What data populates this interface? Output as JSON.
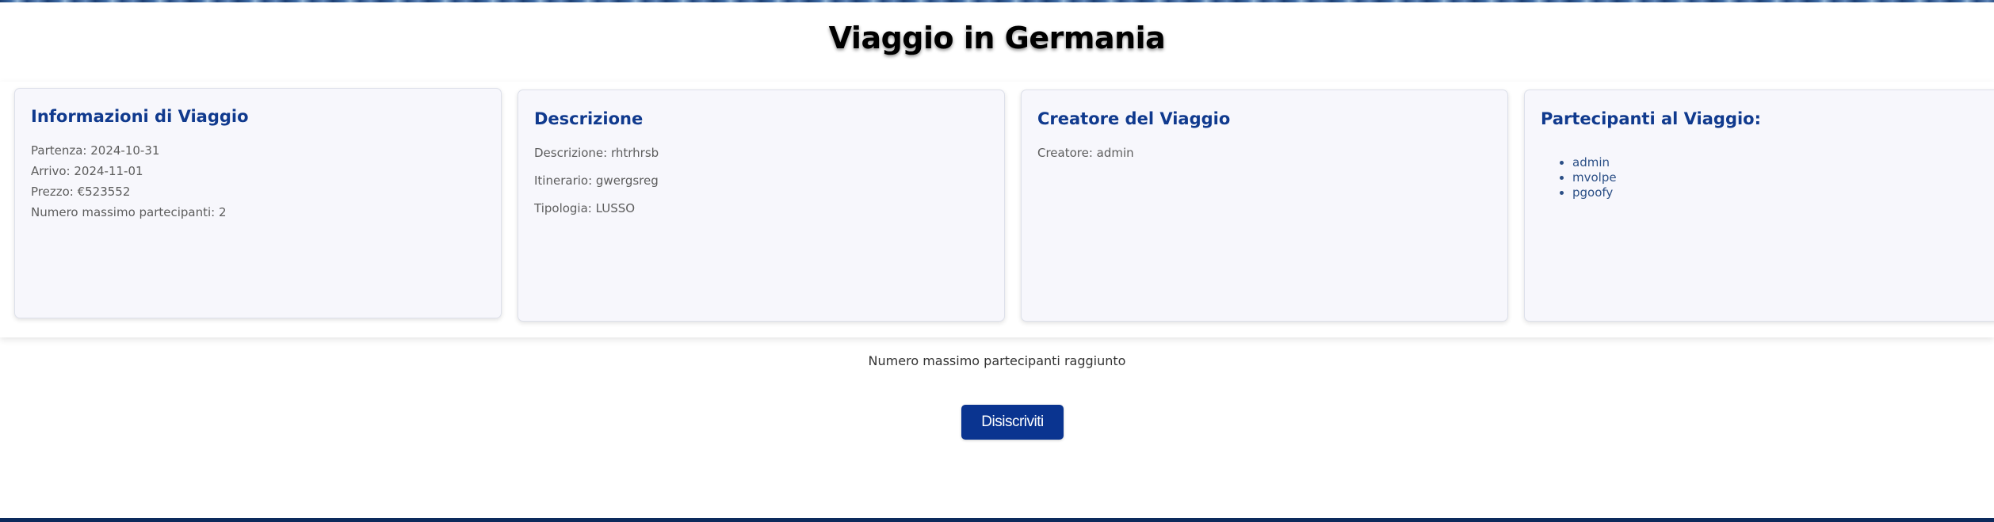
{
  "page": {
    "title": "Viaggio in Germania"
  },
  "travel_info": {
    "heading": "Informazioni di Viaggio",
    "lines": [
      "Partenza: 2024-10-31",
      "Arrivo: 2024-11-01",
      "Prezzo: €523552",
      "Numero massimo partecipanti: 2"
    ]
  },
  "description": {
    "heading": "Descrizione",
    "lines": [
      "Descrizione: rhtrhrsb",
      "Itinerario: gwergsreg",
      "Tipologia: LUSSO"
    ]
  },
  "creator": {
    "heading": "Creatore del Viaggio",
    "line": "Creatore: admin"
  },
  "participants": {
    "heading": "Partecipanti al Viaggio:",
    "items": [
      "admin",
      "mvolpe",
      "pgoofy"
    ]
  },
  "status": {
    "message": "Numero massimo partecipanti raggiunto"
  },
  "actions": {
    "unsubscribe_label": "Disiscriviti"
  },
  "colors": {
    "heading_blue": "#103a8e",
    "button_blue": "#0a3490",
    "footer_navy": "#0c2a5c"
  }
}
